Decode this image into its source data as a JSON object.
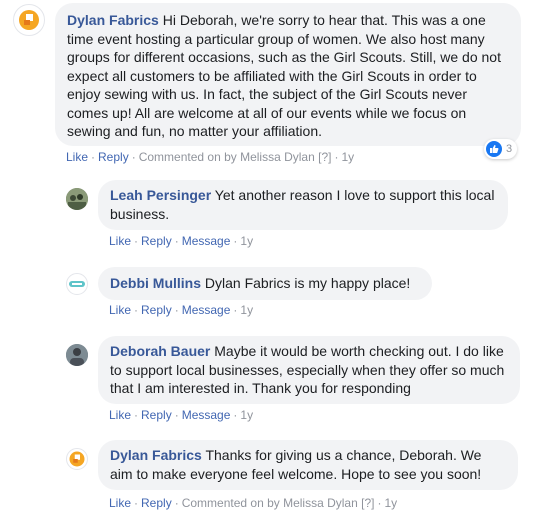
{
  "comments": [
    {
      "author": "Dylan Fabrics",
      "text": "Hi Deborah, we're sorry to hear that. This was a one time event hosting a particular group of women. We also host many groups for different occasions, such as the Girl Scouts. Still, we do not expect all customers to be affiliated with the Girl Scouts in order to enjoy sewing with us. In fact, the subject of the Girl Scouts never comes up! All are welcome at all of our events while we focus on sewing and fun, no matter your affiliation.",
      "actions": {
        "like": "Like",
        "reply": "Reply",
        "meta": "Commented on by Melissa Dylan",
        "help": "[?]",
        "time": "1y"
      },
      "reaction_count": "3"
    },
    {
      "author": "Leah Persinger",
      "text": "Yet another reason I love to support this local business.",
      "actions": {
        "like": "Like",
        "reply": "Reply",
        "message": "Message",
        "time": "1y"
      }
    },
    {
      "author": "Debbi Mullins",
      "text": "Dylan Fabrics is my happy place!",
      "actions": {
        "like": "Like",
        "reply": "Reply",
        "message": "Message",
        "time": "1y"
      }
    },
    {
      "author": "Deborah Bauer",
      "text": "Maybe it would be worth checking out. I do like to support local businesses, especially when they offer so much that I am interested in. Thank you for responding",
      "actions": {
        "like": "Like",
        "reply": "Reply",
        "message": "Message",
        "time": "1y"
      }
    },
    {
      "author": "Dylan Fabrics",
      "text": "Thanks for giving us a chance, Deborah. We aim to make everyone feel welcome. Hope to see you soon!",
      "actions": {
        "like": "Like",
        "reply": "Reply",
        "meta": "Commented on by Melissa Dylan",
        "help": "[?]",
        "time": "1y"
      }
    }
  ],
  "colors": {
    "author": "#385898",
    "link": "#4267b2",
    "bubble": "#f2f3f5",
    "muted": "#90949c",
    "brand_orange": "#f5a623"
  }
}
